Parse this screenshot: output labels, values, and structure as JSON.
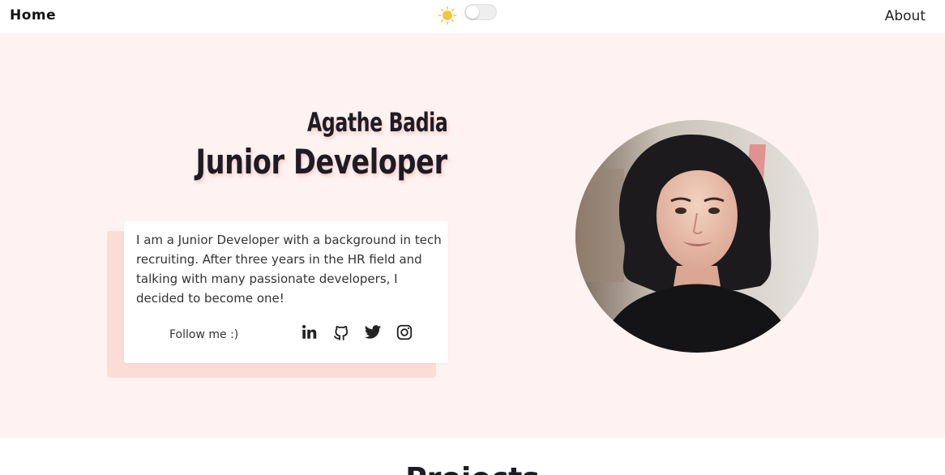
{
  "nav": {
    "home_label": "Home",
    "about_label": "About",
    "theme_icon": "sun-icon",
    "theme_toggle_state": "light"
  },
  "hero": {
    "name": "Agathe Badia",
    "role": "Junior Developer",
    "bio": "I am a Junior Developer with a background in tech recruiting. After three years in the HR field and talking with many passionate developers, I decided to become one!",
    "follow_label": "Follow me :)",
    "socials": [
      {
        "name": "linkedin-icon"
      },
      {
        "name": "github-icon"
      },
      {
        "name": "twitter-icon"
      },
      {
        "name": "instagram-icon"
      }
    ],
    "photo_icon": "profile-photo"
  },
  "projects": {
    "title": "Projects"
  },
  "colors": {
    "hero_background": "#fff3f1",
    "card_shadow": "#fbddd8",
    "text_dark": "#1c1c24",
    "sun": "#f5c542"
  }
}
